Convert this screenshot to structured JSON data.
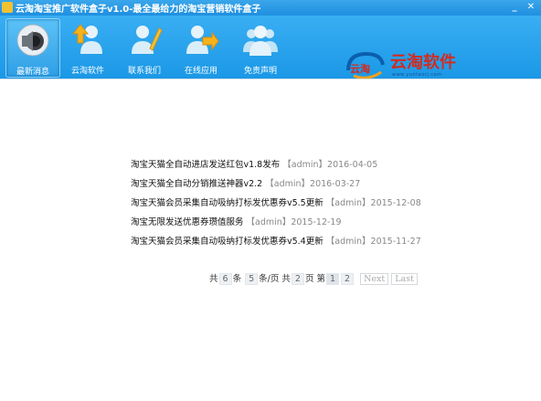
{
  "window": {
    "title": "云淘淘宝推广软件盒子v1.0-最全最给力的淘宝营销软件盒子",
    "minimize_glyph": "_",
    "close_glyph": "✕"
  },
  "toolbar": {
    "items": [
      {
        "label": "最新消息",
        "icon": "speaker-icon",
        "active": true
      },
      {
        "label": "云淘软件",
        "icon": "user-upload-icon"
      },
      {
        "label": "联系我们",
        "icon": "user-edit-icon"
      },
      {
        "label": "在线应用",
        "icon": "user-forward-icon"
      },
      {
        "label": "免责声明",
        "icon": "user-group-icon"
      }
    ]
  },
  "brand": {
    "mark_text": "云淘",
    "name": "云淘软件",
    "url": "www.yuntaorj.com"
  },
  "news": {
    "items": [
      {
        "title": "淘宝天猫全自动进店发送红包v1.8发布",
        "author": "【admin】",
        "date": "2016-04-05"
      },
      {
        "title": "淘宝天猫全自动分销推送神器v2.2",
        "author": "【admin】",
        "date": "2016-03-27"
      },
      {
        "title": "淘宝天猫会员采集自动吸纳打标发优惠券v5.5更新",
        "author": "【admin】",
        "date": "2015-12-08"
      },
      {
        "title": "淘宝无限发送优惠券瓒值服务 ",
        "author": "【admin】",
        "date": "2015-12-19"
      },
      {
        "title": "淘宝天猫会员采集自动吸纳打标发优惠券v5.4更新",
        "author": "【admin】",
        "date": "2015-11-27"
      }
    ]
  },
  "pager": {
    "t1": "共",
    "total_items": "6",
    "t2": "条",
    "per_page": "5",
    "t3": "条/页 共",
    "total_pages": "2",
    "t4": "页 第",
    "page1": "1",
    "page2": "2",
    "next": "Next",
    "last": "Last"
  }
}
